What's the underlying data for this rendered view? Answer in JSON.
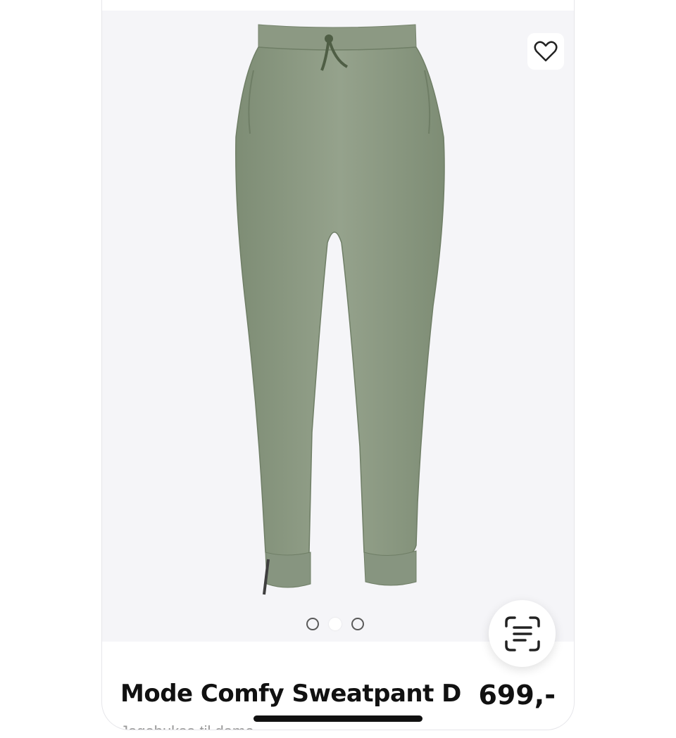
{
  "product": {
    "name": "Mode Comfy Sweatpant D",
    "price": "699,-",
    "subtitle": "Jogebukse til dame",
    "color": "#8a9a80"
  },
  "gallery": {
    "image_count": 3,
    "active_index": 1
  },
  "icons": {
    "favorite": "heart-outline-icon",
    "scan": "text-scan-icon"
  }
}
